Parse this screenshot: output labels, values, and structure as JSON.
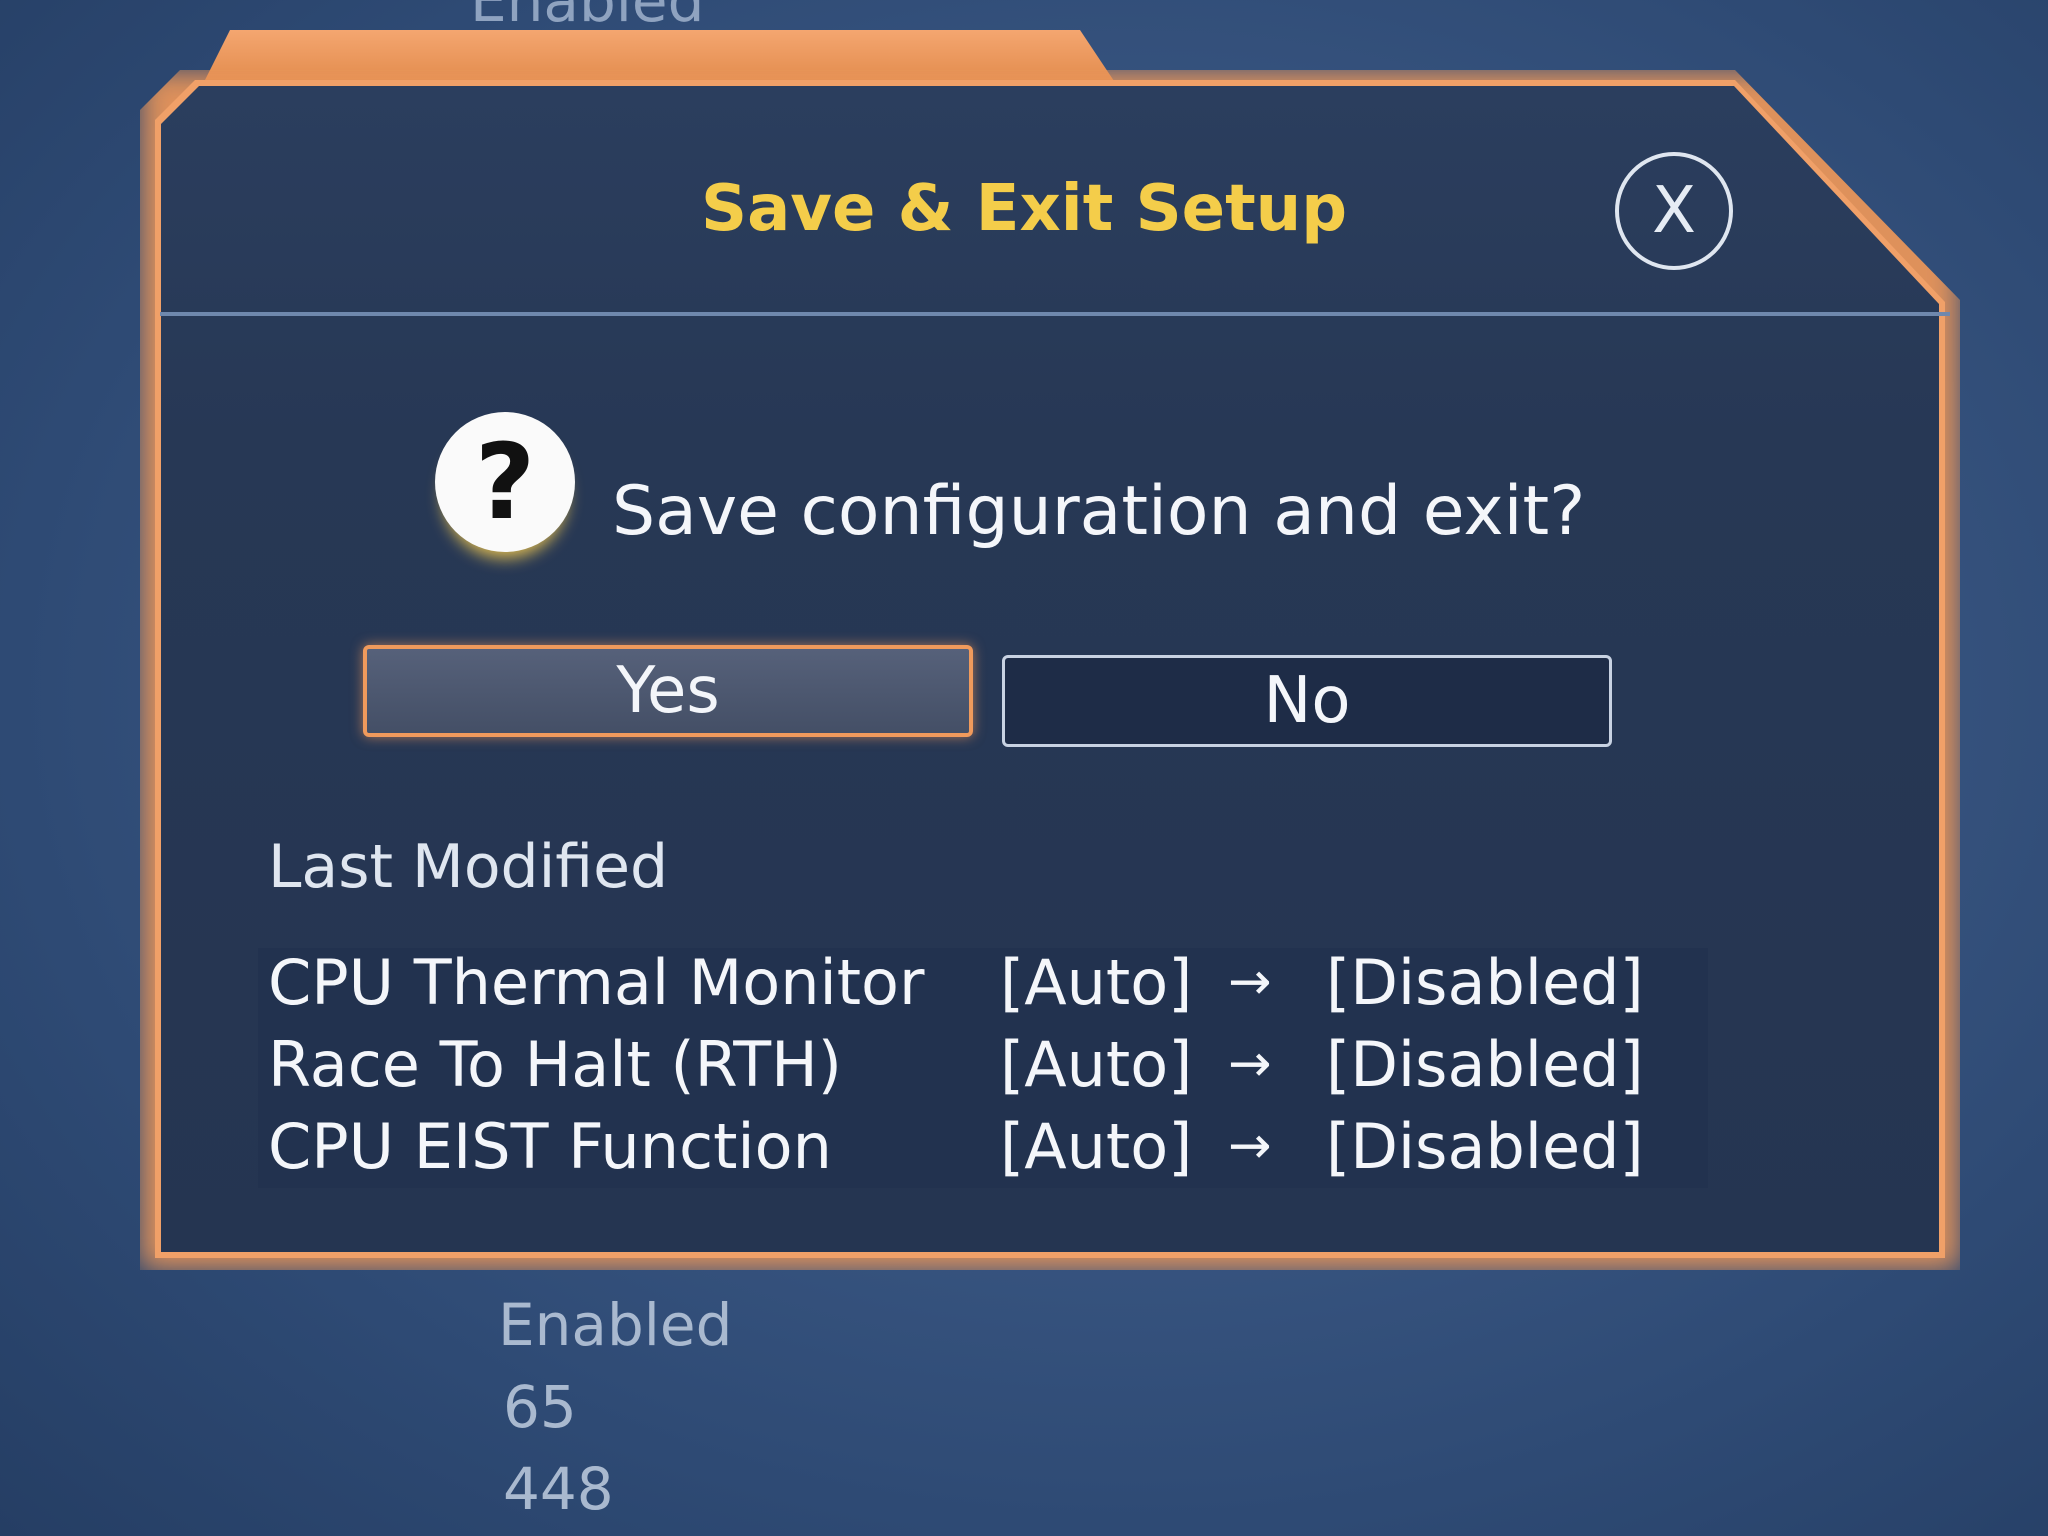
{
  "background": {
    "top_value": "Enabled",
    "values_below": [
      "Enabled",
      "65",
      "448"
    ]
  },
  "dialog": {
    "title": "Save & Exit Setup",
    "close_glyph": "X",
    "question_icon": "?",
    "question": "Save configuration and exit?",
    "buttons": {
      "yes": "Yes",
      "no": "No"
    },
    "selected_button": "yes",
    "last_modified_label": "Last Modified",
    "changes": [
      {
        "setting": "CPU Thermal Monitor",
        "old": "[Auto]",
        "arrow": "→",
        "new": "[Disabled]"
      },
      {
        "setting": "Race To Halt (RTH)",
        "old": "[Auto]",
        "arrow": "→",
        "new": "[Disabled]"
      },
      {
        "setting": "CPU EIST Function",
        "old": "[Auto]",
        "arrow": "→",
        "new": "[Disabled]"
      }
    ]
  },
  "colors": {
    "accent_orange": "#f0a068",
    "title_yellow": "#f4cd4a",
    "dialog_bg": "#273855"
  }
}
